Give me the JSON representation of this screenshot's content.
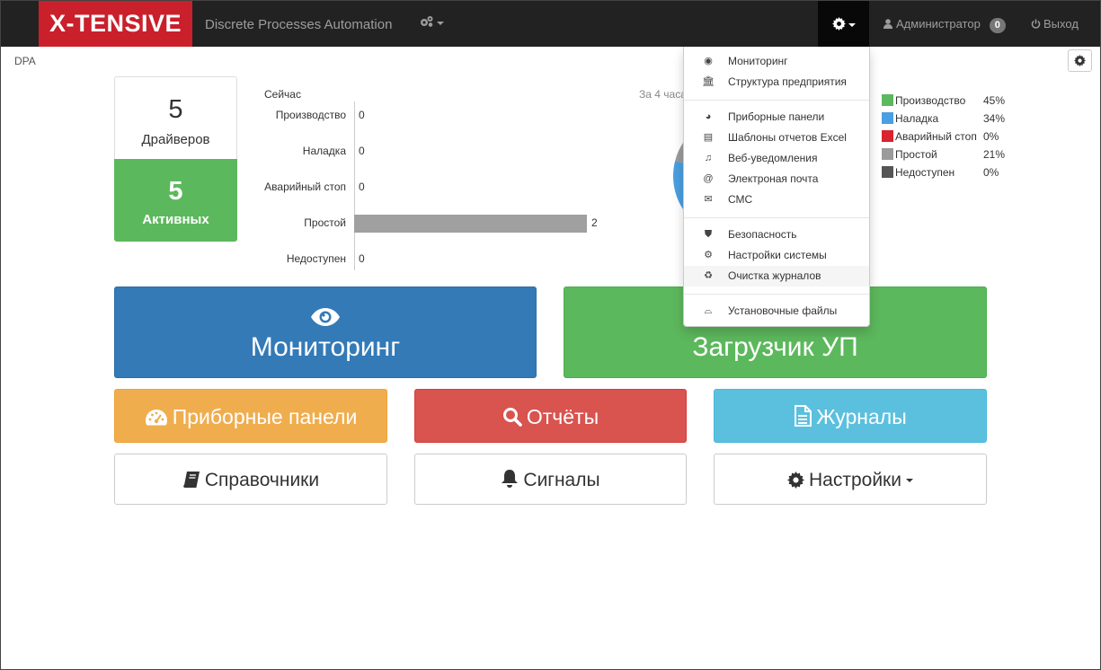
{
  "navbar": {
    "brand": "X-TENSIVE",
    "app_title": "Discrete Processes Automation",
    "user": "Администратор",
    "notifications": "0",
    "logout": "Выход"
  },
  "breadcrumb": "DPA",
  "drivers": {
    "total": "5",
    "total_label": "Драйверов",
    "active": "5",
    "active_label": "Активных"
  },
  "now_chart": {
    "title": "Сейчас",
    "period": "За 4 часа"
  },
  "chart_data": [
    {
      "type": "bar",
      "title": "Сейчас",
      "categories": [
        "Производство",
        "Наладка",
        "Аварийный стоп",
        "Простой",
        "Недоступен"
      ],
      "values": [
        0,
        0,
        0,
        2,
        0
      ],
      "xlim": [
        0,
        2
      ]
    },
    {
      "type": "pie",
      "title": "За 4 часа",
      "labels": [
        "Производство",
        "Наладка",
        "Аварийный стоп",
        "Простой",
        "Недоступен"
      ],
      "values": [
        45,
        34,
        0,
        21,
        0
      ],
      "value_labels": [
        "45%",
        "34%",
        "0%",
        "21%",
        "0%"
      ],
      "colors": [
        "#5cb85c",
        "#4a9fe0",
        "#d9232e",
        "#9b9b9b",
        "#555555"
      ],
      "legend": "right"
    }
  ],
  "tiles": {
    "monitoring": "Мониторинг",
    "loader": "Загрузчик УП",
    "panels": "Приборные панели",
    "reports": "Отчёты",
    "journals": "Журналы",
    "references": "Справочники",
    "signals": "Сигналы",
    "settings": "Настройки"
  },
  "dropdown": {
    "items": [
      {
        "label": "Мониторинг",
        "icon": "eye-icon"
      },
      {
        "label": "Структура предприятия",
        "icon": "bank-icon"
      },
      {
        "label": "Приборные панели",
        "icon": "dashboard-icon"
      },
      {
        "label": "Шаблоны отчетов Excel",
        "icon": "excel-file-icon"
      },
      {
        "label": "Веб-уведомления",
        "icon": "bell-icon"
      },
      {
        "label": "Электроная почта",
        "icon": "at-icon"
      },
      {
        "label": "СМС",
        "icon": "envelope-icon"
      },
      {
        "label": "Безопасность",
        "icon": "shield-icon"
      },
      {
        "label": "Настройки системы",
        "icon": "cogs-icon"
      },
      {
        "label": "Очистка журналов",
        "icon": "recycle-icon"
      },
      {
        "label": "Установочные файлы",
        "icon": "drive-icon"
      }
    ]
  }
}
